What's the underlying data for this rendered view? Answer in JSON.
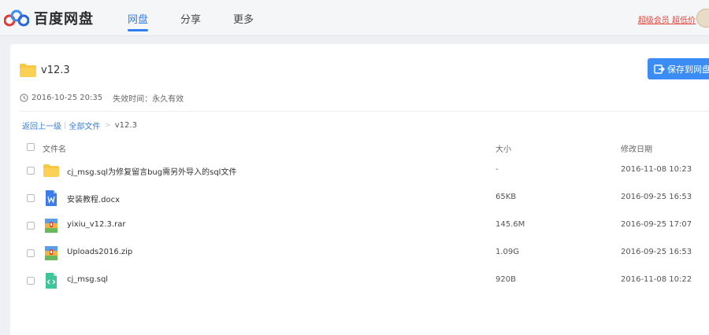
{
  "brand": {
    "name": "百度网盘"
  },
  "nav": {
    "tabs": [
      {
        "label": "网盘"
      },
      {
        "label": "分享"
      },
      {
        "label": "更多"
      }
    ]
  },
  "header": {
    "promo_label": "超级会员 超低价"
  },
  "share": {
    "title": "v12.3",
    "save_label": "保存到网盘",
    "created": "2016-10-25 20:35",
    "expire_label": "失效时间：永久有效"
  },
  "breadcrumb": {
    "back": "返回上一级",
    "sep": "|",
    "root": "全部文件",
    "arrow": ">",
    "current": "v12.3"
  },
  "table": {
    "headers": {
      "name": "文件名",
      "size": "大小",
      "date": "修改日期"
    },
    "rows": [
      {
        "name": "cj_msg.sql为修复留言bug需另外导入的sql文件",
        "size": "-",
        "date": "2016-11-08 10:23",
        "icon": "folder-icon"
      },
      {
        "name": "安装教程.docx",
        "size": "65KB",
        "date": "2016-09-25 16:53",
        "icon": "word-doc-icon"
      },
      {
        "name": "yixiu_v12.3.rar",
        "size": "145.6M",
        "date": "2016-09-25 17:07",
        "icon": "archive-icon"
      },
      {
        "name": "Uploads2016.zip",
        "size": "1.09G",
        "date": "2016-09-25 16:53",
        "icon": "archive-icon"
      },
      {
        "name": "cj_msg.sql",
        "size": "920B",
        "date": "2016-11-08 10:22",
        "icon": "code-file-icon"
      }
    ]
  },
  "colors": {
    "accent": "#2e7ef2",
    "promo": "#e0483b",
    "folder": "#f8c843",
    "word": "#3b7ce8",
    "code": "#3ec59a"
  }
}
